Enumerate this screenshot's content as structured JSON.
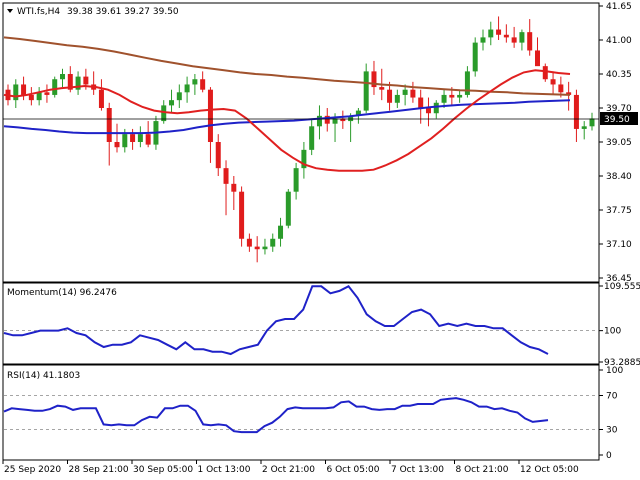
{
  "header": {
    "symbol": "WTI.fs,H4",
    "ohlc": "39.38 39.61 39.27 39.50",
    "current_price_label": "39.50"
  },
  "price_axis": {
    "ticks": [
      "41.65",
      "41.00",
      "40.35",
      "39.70",
      "39.05",
      "38.40",
      "37.75",
      "37.10",
      "36.45"
    ]
  },
  "momentum_panel": {
    "title": "Momentum(14) 96.2476",
    "ticks": [
      "109.5558",
      "100",
      "93.2885"
    ]
  },
  "rsi_panel": {
    "title": "RSI(14) 41.1803",
    "ticks": [
      "100",
      "70",
      "30",
      "0"
    ]
  },
  "time_axis": {
    "labels": [
      "25 Sep 2020",
      "28 Sep 21:00",
      "30 Sep 05:00",
      "1 Oct 13:00",
      "2 Oct 21:00",
      "6 Oct 05:00",
      "7 Oct 13:00",
      "8 Oct 21:00",
      "12 Oct 05:00"
    ]
  },
  "colors": {
    "bull": "#2a9b2a",
    "bear": "#e01c1c",
    "ma_fast": "#e02020",
    "ma_slow": "#1f22c8",
    "ma_long": "#a0522d",
    "indicator": "#1f22c8"
  },
  "chart_data": [
    {
      "type": "candlestick",
      "title": "WTI.fs,H4",
      "ylim": [
        36.45,
        41.65
      ],
      "series": [
        {
          "name": "candles",
          "ohlc": [
            [
              40.05,
              40.15,
              39.75,
              39.85
            ],
            [
              39.85,
              40.25,
              39.7,
              40.15
            ],
            [
              40.15,
              40.3,
              39.85,
              39.95
            ],
            [
              39.95,
              40.1,
              39.75,
              39.85
            ],
            [
              39.85,
              40.1,
              39.75,
              40.0
            ],
            [
              40.0,
              40.15,
              39.8,
              39.95
            ],
            [
              39.95,
              40.3,
              39.9,
              40.25
            ],
            [
              40.25,
              40.45,
              40.1,
              40.35
            ],
            [
              40.35,
              40.5,
              40.0,
              40.05
            ],
            [
              40.05,
              40.4,
              39.95,
              40.3
            ],
            [
              40.3,
              40.45,
              40.05,
              40.15
            ],
            [
              40.15,
              40.4,
              39.95,
              40.05
            ],
            [
              40.05,
              40.25,
              39.65,
              39.7
            ],
            [
              39.7,
              39.8,
              38.6,
              39.05
            ],
            [
              39.05,
              39.4,
              38.85,
              38.95
            ],
            [
              38.95,
              39.3,
              38.85,
              39.2
            ],
            [
              39.2,
              39.3,
              38.9,
              39.05
            ],
            [
              39.05,
              39.35,
              38.95,
              39.2
            ],
            [
              39.2,
              39.45,
              38.95,
              39.0
            ],
            [
              39.0,
              39.55,
              38.9,
              39.45
            ],
            [
              39.45,
              39.85,
              39.4,
              39.75
            ],
            [
              39.75,
              40.05,
              39.6,
              39.85
            ],
            [
              39.85,
              40.15,
              39.7,
              40.0
            ],
            [
              40.0,
              40.3,
              39.8,
              40.15
            ],
            [
              40.15,
              40.35,
              39.95,
              40.25
            ],
            [
              40.25,
              40.4,
              40.0,
              40.05
            ],
            [
              40.05,
              40.1,
              38.65,
              39.05
            ],
            [
              39.05,
              39.2,
              38.4,
              38.55
            ],
            [
              38.55,
              38.7,
              37.65,
              38.25
            ],
            [
              38.25,
              38.4,
              37.75,
              38.1
            ],
            [
              38.1,
              38.2,
              37.05,
              37.2
            ],
            [
              37.2,
              37.3,
              36.95,
              37.05
            ],
            [
              37.05,
              37.25,
              36.75,
              37.0
            ],
            [
              37.0,
              37.2,
              36.9,
              37.05
            ],
            [
              37.05,
              37.3,
              36.95,
              37.2
            ],
            [
              37.2,
              37.6,
              37.05,
              37.45
            ],
            [
              37.45,
              38.15,
              37.4,
              38.1
            ],
            [
              38.1,
              38.65,
              37.95,
              38.55
            ],
            [
              38.55,
              39.05,
              38.35,
              38.9
            ],
            [
              38.9,
              39.5,
              38.8,
              39.35
            ],
            [
              39.35,
              39.75,
              39.1,
              39.55
            ],
            [
              39.55,
              39.7,
              39.25,
              39.4
            ],
            [
              39.4,
              39.6,
              39.05,
              39.5
            ],
            [
              39.5,
              39.65,
              39.3,
              39.45
            ],
            [
              39.45,
              39.6,
              39.05,
              39.55
            ],
            [
              39.55,
              39.7,
              39.4,
              39.65
            ],
            [
              39.65,
              40.55,
              39.6,
              40.4
            ],
            [
              40.4,
              40.6,
              39.95,
              40.1
            ],
            [
              40.1,
              40.45,
              39.85,
              40.05
            ],
            [
              40.05,
              40.2,
              39.65,
              39.8
            ],
            [
              39.8,
              40.05,
              39.7,
              39.95
            ],
            [
              39.95,
              40.15,
              39.75,
              40.05
            ],
            [
              40.05,
              40.2,
              39.8,
              39.9
            ],
            [
              39.9,
              40.05,
              39.4,
              39.7
            ],
            [
              39.7,
              39.9,
              39.35,
              39.6
            ],
            [
              39.6,
              39.85,
              39.5,
              39.8
            ],
            [
              39.8,
              40.05,
              39.7,
              39.95
            ],
            [
              39.95,
              40.1,
              39.75,
              39.9
            ],
            [
              39.9,
              40.05,
              39.8,
              39.95
            ],
            [
              39.95,
              40.5,
              39.9,
              40.4
            ],
            [
              40.4,
              41.05,
              40.3,
              40.95
            ],
            [
              40.95,
              41.2,
              40.8,
              41.05
            ],
            [
              41.05,
              41.35,
              40.9,
              41.2
            ],
            [
              41.2,
              41.45,
              41.0,
              41.1
            ],
            [
              41.1,
              41.3,
              40.95,
              41.05
            ],
            [
              41.05,
              41.25,
              40.85,
              40.95
            ],
            [
              40.95,
              41.2,
              40.8,
              41.15
            ],
            [
              41.15,
              41.4,
              40.7,
              40.8
            ],
            [
              40.8,
              41.05,
              40.6,
              40.5
            ],
            [
              40.5,
              40.55,
              40.2,
              40.25
            ],
            [
              40.25,
              40.4,
              39.95,
              40.15
            ],
            [
              40.15,
              40.3,
              39.9,
              40.0
            ],
            [
              40.0,
              40.2,
              39.65,
              39.95
            ],
            [
              39.95,
              40.05,
              39.05,
              39.3
            ],
            [
              39.3,
              39.45,
              39.1,
              39.35
            ],
            [
              39.35,
              39.61,
              39.27,
              39.5
            ]
          ]
        },
        {
          "name": "MA fast",
          "values": [
            39.95,
            39.92,
            39.95,
            40.0,
            40.05,
            40.08,
            40.1,
            40.12,
            40.1,
            40.05,
            39.95,
            39.82,
            39.72,
            39.65,
            39.62,
            39.6,
            39.62,
            39.65,
            39.67,
            39.68,
            39.65,
            39.5,
            39.3,
            39.1,
            38.9,
            38.75,
            38.62,
            38.55,
            38.52,
            38.5,
            38.5,
            38.5,
            38.52,
            38.6,
            38.7,
            38.82,
            38.97,
            39.12,
            39.3,
            39.5,
            39.68,
            39.85,
            40.0,
            40.15,
            40.28,
            40.38,
            40.42,
            40.4,
            40.37,
            40.35
          ]
        },
        {
          "name": "MA slow",
          "values": [
            39.35,
            39.33,
            39.3,
            39.28,
            39.25,
            39.23,
            39.22,
            39.22,
            39.22,
            39.22,
            39.22,
            39.23,
            39.25,
            39.28,
            39.33,
            39.37,
            39.4,
            39.42,
            39.43,
            39.44,
            39.45,
            39.46,
            39.48,
            39.5,
            39.52,
            39.54,
            39.57,
            39.6,
            39.63,
            39.66,
            39.69,
            39.72,
            39.74,
            39.76,
            39.77,
            39.78,
            39.79,
            39.8,
            39.82,
            39.83,
            39.84,
            39.85
          ]
        },
        {
          "name": "MA long",
          "values": [
            41.05,
            41.02,
            40.98,
            40.94,
            40.9,
            40.87,
            40.83,
            40.78,
            40.72,
            40.66,
            40.6,
            40.55,
            40.5,
            40.46,
            40.42,
            40.38,
            40.35,
            40.33,
            40.3,
            40.28,
            40.25,
            40.22,
            40.2,
            40.18,
            40.15,
            40.13,
            40.1,
            40.08,
            40.06,
            40.04,
            40.03,
            40.01,
            40.0,
            39.98,
            39.97,
            39.96,
            39.95
          ]
        }
      ]
    },
    {
      "type": "line",
      "title": "Momentum(14) 96.2476",
      "ylim": [
        93.2885,
        109.5558
      ],
      "series": [
        {
          "name": "Momentum(14)",
          "values": [
            99.5,
            99.0,
            99.0,
            99.5,
            100.0,
            100.0,
            100.0,
            100.5,
            99.5,
            99.0,
            97.5,
            96.5,
            97.0,
            97.0,
            97.5,
            99.0,
            98.5,
            98.0,
            97.0,
            96.0,
            97.5,
            96.0,
            96.0,
            95.5,
            95.5,
            95.0,
            96.0,
            96.5,
            97.0,
            100.0,
            102.0,
            102.5,
            102.5,
            104.5,
            109.5,
            109.5,
            108.0,
            108.5,
            109.5,
            107.0,
            103.5,
            102.0,
            101.0,
            101.0,
            102.5,
            104.0,
            104.5,
            103.5,
            101.0,
            101.5,
            101.0,
            101.5,
            101.0,
            101.0,
            100.5,
            100.5,
            99.0,
            97.5,
            96.5,
            96.0,
            95.0
          ]
        }
      ]
    },
    {
      "type": "line",
      "title": "RSI(14) 41.1803",
      "ylim": [
        0,
        100
      ],
      "series": [
        {
          "name": "RSI(14)",
          "values": [
            51,
            55,
            54,
            53,
            52,
            52,
            54,
            58,
            57,
            53,
            55,
            55,
            55,
            36,
            35,
            36,
            35,
            35,
            41,
            45,
            44,
            55,
            55,
            58,
            58,
            52,
            36,
            35,
            36,
            35,
            28,
            27,
            27,
            27,
            34,
            38,
            45,
            54,
            56,
            55,
            55,
            55,
            55,
            56,
            62,
            63,
            57,
            57,
            54,
            53,
            54,
            54,
            58,
            58,
            60,
            60,
            60,
            65,
            66,
            67,
            65,
            62,
            57,
            57,
            54,
            55,
            52,
            50,
            43,
            39,
            40,
            41
          ]
        }
      ]
    }
  ]
}
